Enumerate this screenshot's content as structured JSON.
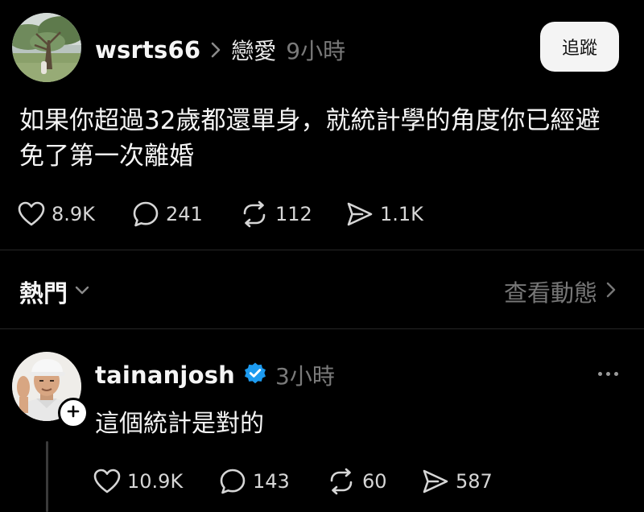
{
  "post": {
    "username": "wsrts66",
    "topic": "戀愛",
    "time": "9小時",
    "follow_label": "追蹤",
    "body": "如果你超過32歲都還單身，就統計學的角度你已經避免了第一次離婚",
    "stats": {
      "likes": "8.9K",
      "replies": "241",
      "reposts": "112",
      "shares": "1.1K"
    }
  },
  "sort": {
    "label": "熱門",
    "view_activity_label": "查看動態"
  },
  "reply": {
    "username": "tainanjosh",
    "time": "3小時",
    "body": "這個統計是對的",
    "verified": true,
    "stats": {
      "likes": "10.9K",
      "replies": "143",
      "reposts": "60",
      "shares": "587"
    }
  },
  "colors": {
    "background": "#000000",
    "text": "#f5f5f5",
    "muted": "#7a7a7a",
    "verified_badge": "#1d9bf0",
    "follow_button_bg": "#f4f4f4"
  },
  "icons": {
    "like": "heart-icon",
    "reply": "speech-bubble-icon",
    "repost": "repost-icon",
    "share": "send-icon",
    "breadcrumb": "chevron-right-icon",
    "sort": "chevron-down-icon",
    "more": "ellipsis-icon",
    "follow": "plus-icon",
    "verified": "verified-badge-icon"
  }
}
